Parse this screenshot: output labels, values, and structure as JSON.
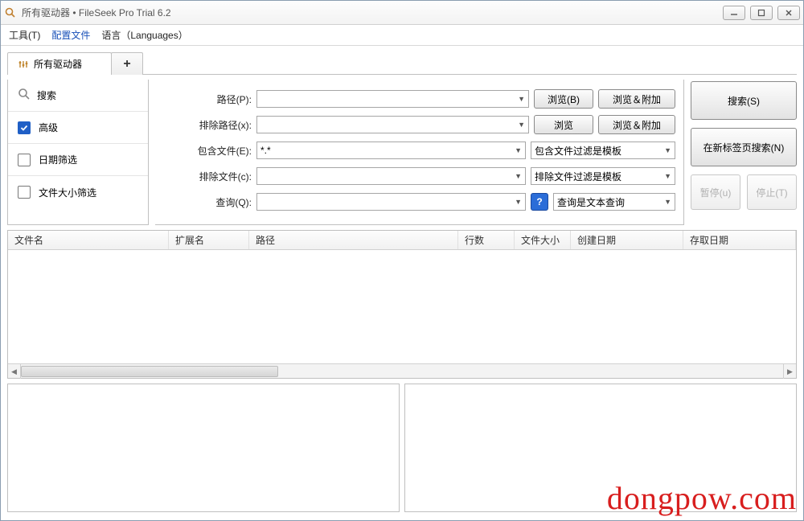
{
  "title": "所有驱动器 • FileSeek Pro Trial 6.2",
  "menu": {
    "tools": "工具(T)",
    "profiles": "配置文件",
    "lang": "语言（Languages）"
  },
  "tabs": {
    "main": "所有驱动器",
    "add": "+"
  },
  "side": {
    "search": "搜索",
    "advanced": "高级",
    "dateFilter": "日期筛选",
    "sizeFilter": "文件大小筛选"
  },
  "form": {
    "pathLabel": "路径(P):",
    "excludePathLabel": "排除路径(x):",
    "includeFileLabel": "包含文件(E):",
    "excludeFileLabel": "排除文件(c):",
    "queryLabel": "查询(Q):",
    "includeFileValue": "*.*",
    "browse": "浏览(B)",
    "browse2": "浏览",
    "browseAppend": "浏览＆附加",
    "includeFilterMode": "包含文件过滤是模板",
    "excludeFilterMode": "排除文件过滤是模板",
    "queryMode": "查询是文本查询"
  },
  "actions": {
    "search": "搜索(S)",
    "newTab": "在新标签页搜索(N)",
    "pause": "暂停(u)",
    "stop": "停止(T)"
  },
  "columns": {
    "filename": "文件名",
    "ext": "扩展名",
    "path": "路径",
    "lines": "行数",
    "size": "文件大小",
    "created": "创建日期",
    "accessed": "存取日期"
  },
  "watermark": "dongpow.com"
}
